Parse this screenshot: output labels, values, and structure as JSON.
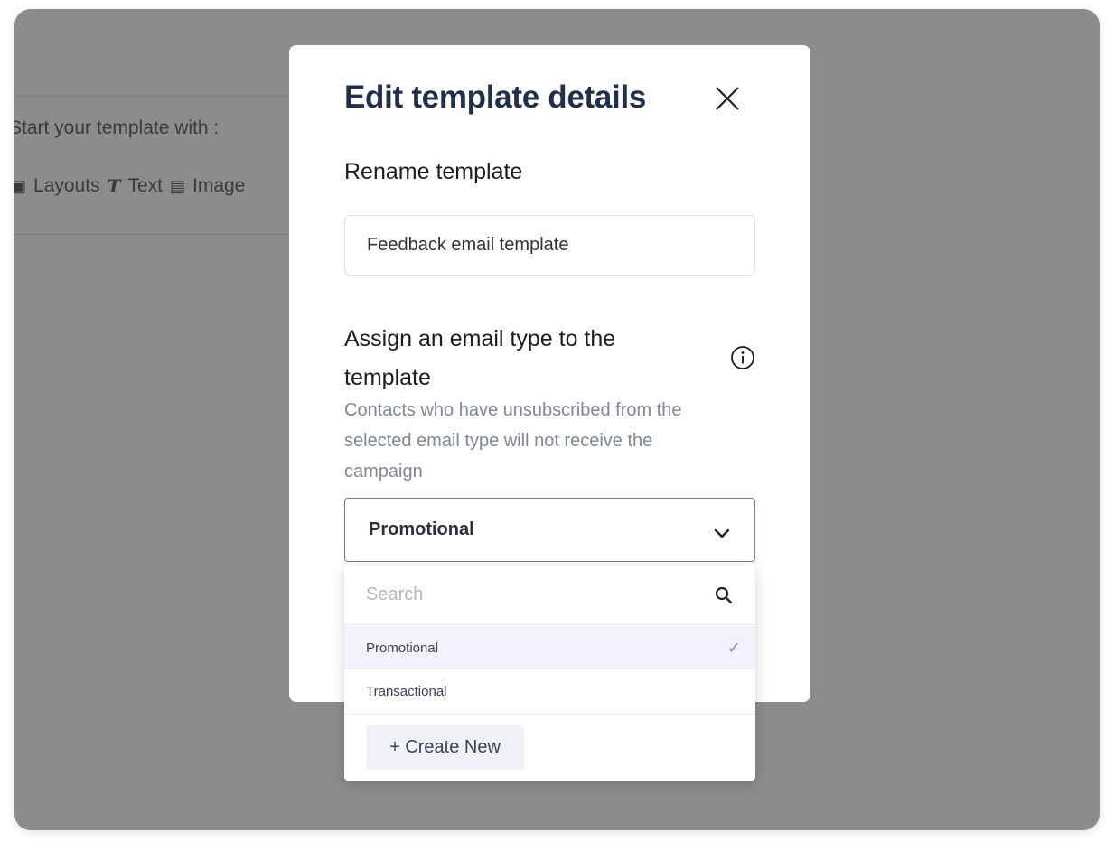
{
  "background": {
    "start_text": "Start your template with :",
    "tools": [
      "Layouts",
      "Text",
      "Image"
    ]
  },
  "modal": {
    "title": "Edit template details",
    "rename_label": "Rename template",
    "template_name": "Feedback email template",
    "assign_label": "Assign an email type to the template",
    "helper_text": "Contacts who have unsubscribed from the selected email type will not receive the campaign",
    "selected_type": "Promotional"
  },
  "dropdown": {
    "search_placeholder": "Search",
    "options": [
      {
        "label": "Promotional",
        "selected": true
      },
      {
        "label": "Transactional",
        "selected": false
      }
    ],
    "create_label": "+ Create New"
  },
  "colors": {
    "overlay": "#8c8c8c",
    "title": "#1f2f4d",
    "accent": "#7b6cd0",
    "selected_bg": "#f3f1fb"
  },
  "icons": [
    "close-icon",
    "info-icon",
    "chevron-down-icon",
    "search-icon",
    "check-icon",
    "layouts-icon",
    "text-icon",
    "image-icon"
  ]
}
